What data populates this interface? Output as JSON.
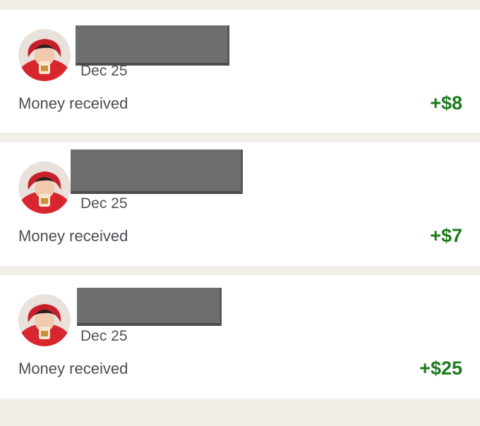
{
  "colors": {
    "page_background": "#f2efe9",
    "card_background": "#ffffff",
    "amount_positive": "#1e7a1e",
    "redaction": "#6e6e6e"
  },
  "transactions": [
    {
      "avatar": "user-avatar-photo",
      "name_redacted": true,
      "date": "Dec 25",
      "description": "Money received",
      "amount": "+$8"
    },
    {
      "avatar": "user-avatar-photo",
      "name_redacted": true,
      "date": "Dec 25",
      "description": "Money received",
      "amount": "+$7"
    },
    {
      "avatar": "user-avatar-photo",
      "name_redacted": true,
      "date": "Dec 25",
      "description": "Money received",
      "amount": "+$25"
    }
  ]
}
